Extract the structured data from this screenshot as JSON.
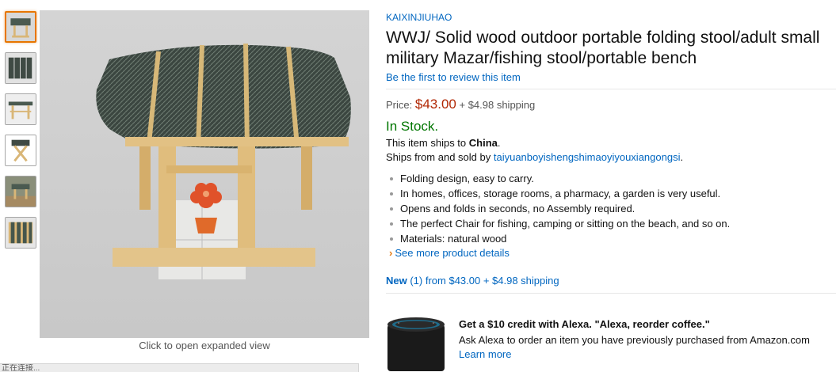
{
  "gallery": {
    "thumbnail_count": 6,
    "selected_thumbnail": 1,
    "expand_caption": "Click to open expanded view"
  },
  "status_bar": {
    "text": "正在连接..."
  },
  "product": {
    "brand": "KAIXINJIUHAO",
    "title": "WWJ/ Solid wood outdoor portable folding stool/adult small military Mazar/fishing stool/portable bench",
    "review_link": "Be the first to review this item",
    "price_label": "Price:",
    "price": "$43.00",
    "shipping": "+ $4.98 shipping",
    "stock": "In Stock.",
    "ships_to_prefix": "This item ships to ",
    "ships_to_country": "China",
    "ships_to_suffix": ".",
    "sold_by_prefix": "Ships from and sold by ",
    "seller": "taiyuanboyishengshimaoyiyouxiangongsi",
    "sold_by_suffix": ".",
    "bullets": [
      "Folding design, easy to carry.",
      "In homes, offices, storage rooms, a pharmacy, a garden is very useful.",
      "Opens and folds in seconds, no Assembly required.",
      "The perfect Chair for fishing, camping or sitting on the beach, and so on.",
      "Materials: natural wood"
    ],
    "more_details": "See more product details",
    "new_label": "New",
    "new_rest": " (1) from $43.00 + $4.98 shipping"
  },
  "alexa_promo": {
    "headline": "Get a $10 credit with Alexa. \"Alexa, reorder coffee.\"",
    "body": "Ask Alexa to order an item you have previously purchased from Amazon.com",
    "learn_more": "Learn more"
  },
  "colors": {
    "link": "#0066c0",
    "price": "#b12704",
    "in_stock": "#007600",
    "thumb_selected_border": "#e77600"
  }
}
